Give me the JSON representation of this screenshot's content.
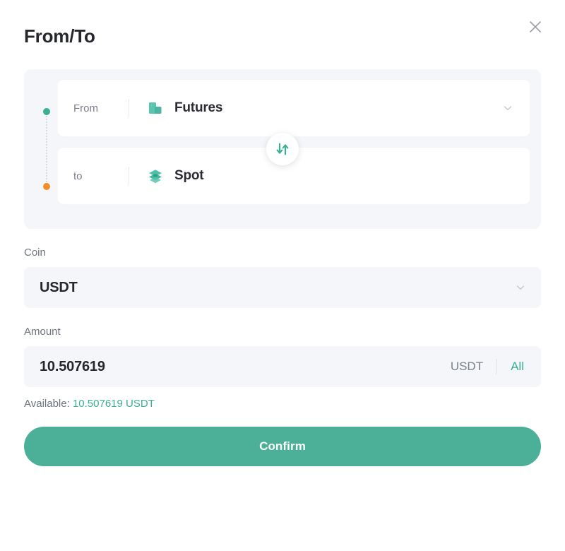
{
  "dialog": {
    "title": "From/To",
    "close_label": "Close"
  },
  "transfer": {
    "from": {
      "label": "From",
      "value": "Futures",
      "icon": "bars-icon",
      "marker_color": "#3aaf92"
    },
    "to": {
      "label": "to",
      "value": "Spot",
      "icon": "layers-icon",
      "marker_color": "#ef8e2a"
    },
    "swap_label": "Swap from and to"
  },
  "coin": {
    "label": "Coin",
    "value": "USDT"
  },
  "amount": {
    "label": "Amount",
    "value": "10.507619",
    "placeholder": "0.00",
    "unit": "USDT",
    "all_label": "All"
  },
  "available": {
    "label": "Available:",
    "value": "10.507619 USDT"
  },
  "actions": {
    "confirm_label": "Confirm"
  },
  "colors": {
    "accent_green": "#3aaf92",
    "button_green": "#4caf98",
    "marker_orange": "#ef8e2a",
    "field_bg": "#f5f6f9",
    "text_dark": "#26272d",
    "text_muted": "#70747f"
  }
}
